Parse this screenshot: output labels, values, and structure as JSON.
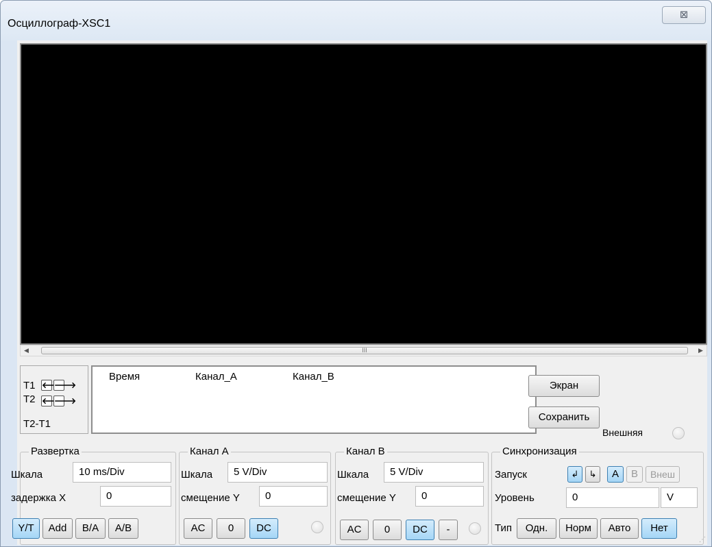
{
  "window": {
    "title": "Осциллограф-XSC1",
    "close_glyph": "⊠"
  },
  "scrollbar": {
    "left_arrow": "◀",
    "right_arrow": "▶",
    "thumb_grip": "III"
  },
  "cursors": {
    "t1_label": "T1",
    "t2_label": "T2",
    "diff_label": "T2-T1",
    "left_glyph": "🡐",
    "right_glyph": "🡒"
  },
  "readout": {
    "headers": [
      "Время",
      "Канал_A",
      "Канал_B"
    ]
  },
  "actions": {
    "screen_label": "Экран",
    "save_label": "Сохранить",
    "external_label": "Внешняя"
  },
  "timebase": {
    "title": "Развертка",
    "scale_label": "Шкала",
    "scale_value": "10 ms/Div",
    "delay_label": "задержка X",
    "delay_value": "0",
    "modes": [
      "Y/T",
      "Add",
      "B/A",
      "A/B"
    ],
    "selected_mode": "Y/T"
  },
  "channel_a": {
    "title": "Канал A",
    "scale_label": "Шкала",
    "scale_value": "5  V/Div",
    "offset_label": "смещение Y",
    "offset_value": "0",
    "coupling": [
      "AC",
      "0",
      "DC"
    ],
    "selected_coupling": "DC"
  },
  "channel_b": {
    "title": "Канал B",
    "scale_label": "Шкала",
    "scale_value": "5  V/Div",
    "offset_label": "смещение Y",
    "offset_value": "0",
    "coupling": [
      "AC",
      "0",
      "DC",
      "-"
    ],
    "selected_coupling": "DC"
  },
  "trigger": {
    "title": "Синхронизация",
    "start_label": "Запуск",
    "edge_rising_glyph": "↲",
    "edge_falling_glyph": "↳",
    "sources": [
      "A",
      "B",
      "Внеш"
    ],
    "selected_source": "A",
    "level_label": "Уровень",
    "level_value": "0",
    "level_unit": "V",
    "type_label": "Тип",
    "types": [
      "Одн.",
      "Норм",
      "Авто",
      "Нет"
    ],
    "selected_type": "Нет"
  },
  "colors": {
    "accent": "#a5d6f6",
    "screen": "#000000"
  }
}
